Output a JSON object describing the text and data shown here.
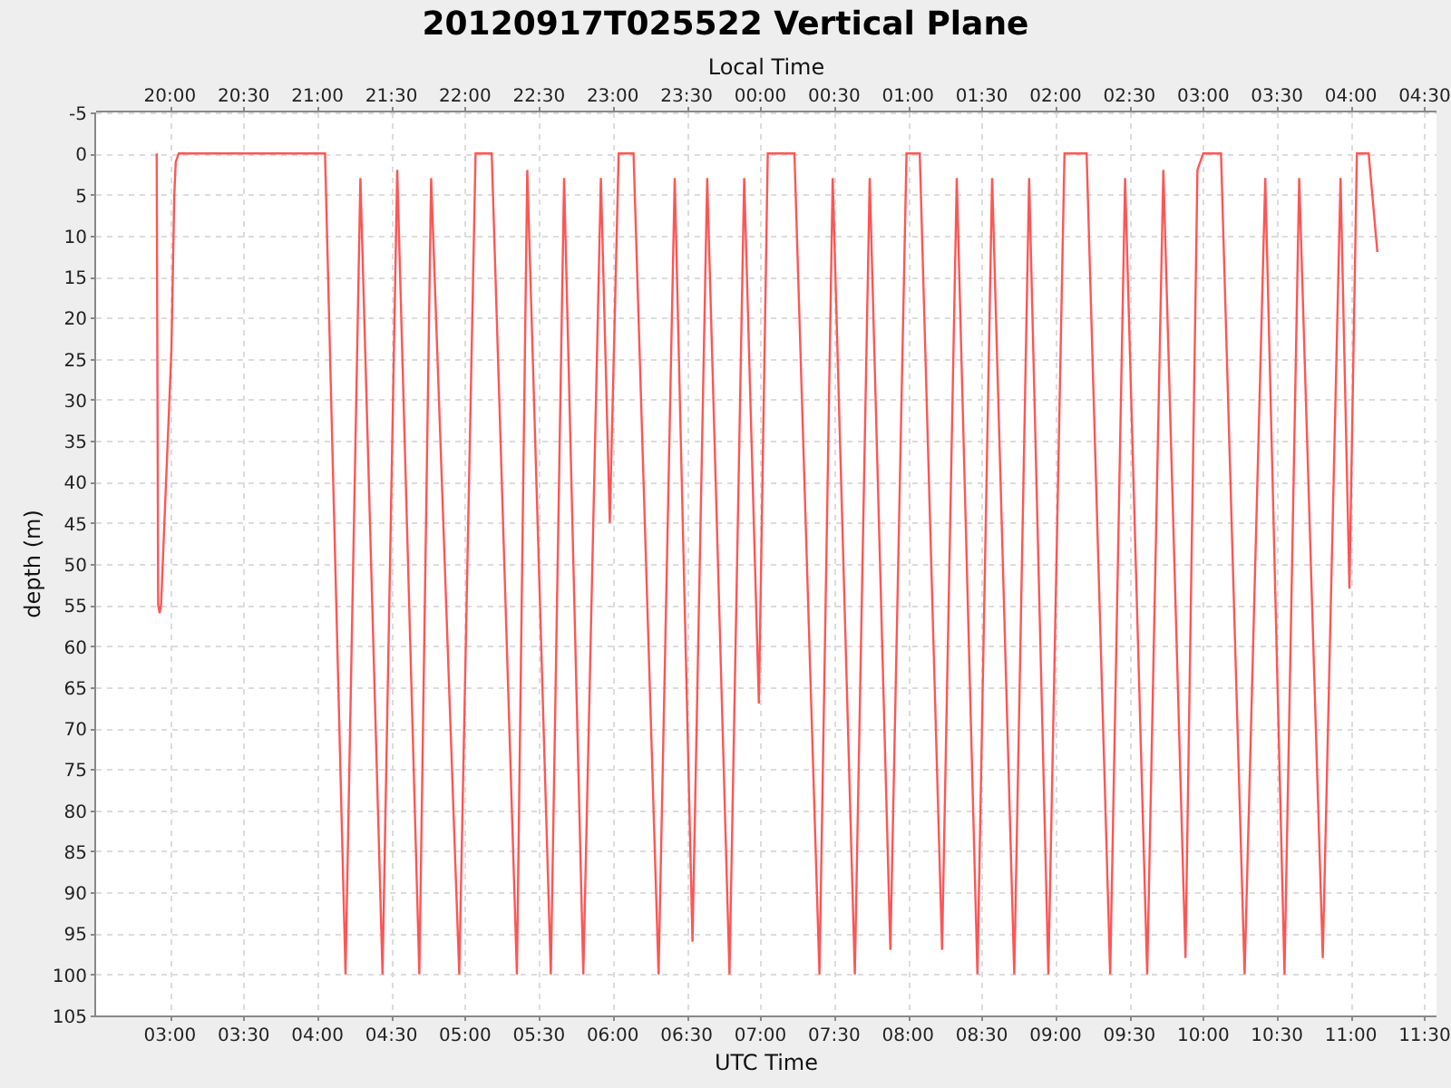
{
  "title": "20120917T025522 Vertical Plane",
  "top_axis": {
    "label": "Local Time",
    "ticks": [
      "20:00",
      "20:30",
      "21:00",
      "21:30",
      "22:00",
      "22:30",
      "23:00",
      "23:30",
      "00:00",
      "00:30",
      "01:00",
      "01:30",
      "02:00",
      "02:30",
      "03:00",
      "03:30",
      "04:00",
      "04:30"
    ]
  },
  "chart_data": {
    "type": "line",
    "xlabel": "UTC Time",
    "ylabel": "depth (m)",
    "grid": true,
    "xlim": [
      2.5,
      11.58
    ],
    "ylim": [
      105,
      -5
    ],
    "yticks": [
      -5,
      0,
      5,
      10,
      15,
      20,
      25,
      30,
      35,
      40,
      45,
      50,
      55,
      60,
      65,
      70,
      75,
      80,
      85,
      90,
      95,
      100,
      105
    ],
    "xticks": [
      {
        "value": 3,
        "label": "03:00"
      },
      {
        "value": 3.5,
        "label": "03:30"
      },
      {
        "value": 4,
        "label": "04:00"
      },
      {
        "value": 4.5,
        "label": "04:30"
      },
      {
        "value": 5,
        "label": "05:00"
      },
      {
        "value": 5.5,
        "label": "05:30"
      },
      {
        "value": 6,
        "label": "06:00"
      },
      {
        "value": 6.5,
        "label": "06:30"
      },
      {
        "value": 7,
        "label": "07:00"
      },
      {
        "value": 7.5,
        "label": "07:30"
      },
      {
        "value": 8,
        "label": "08:00"
      },
      {
        "value": 8.5,
        "label": "08:30"
      },
      {
        "value": 9,
        "label": "09:00"
      },
      {
        "value": 9.5,
        "label": "09:30"
      },
      {
        "value": 10,
        "label": "10:00"
      },
      {
        "value": 10.5,
        "label": "10:30"
      },
      {
        "value": 11,
        "label": "11:00"
      },
      {
        "value": 11.5,
        "label": "11:30"
      }
    ],
    "x": [
      2.91,
      2.92,
      2.93,
      2.94,
      3.01,
      3.03,
      3.04,
      3.06,
      4.05,
      4.19,
      4.29,
      4.44,
      4.54,
      4.69,
      4.77,
      4.96,
      5.07,
      5.18,
      5.35,
      5.42,
      5.58,
      5.67,
      5.8,
      5.92,
      5.98,
      6.04,
      6.14,
      6.31,
      6.42,
      6.54,
      6.64,
      6.79,
      6.89,
      6.99,
      7.05,
      7.23,
      7.4,
      7.49,
      7.64,
      7.74,
      7.88,
      7.99,
      8.08,
      8.23,
      8.33,
      8.47,
      8.57,
      8.72,
      8.82,
      8.95,
      9.06,
      9.21,
      9.37,
      9.47,
      9.62,
      9.73,
      9.88,
      9.96,
      10.0,
      10.12,
      10.28,
      10.42,
      10.55,
      10.65,
      10.81,
      10.93,
      10.99,
      11.04,
      11.12,
      11.18
    ],
    "series": [
      {
        "color": "#ff5555",
        "values": [
          0,
          55,
          56,
          55,
          24,
          5,
          1,
          0,
          0,
          100,
          3,
          100,
          2,
          100,
          3,
          100,
          0,
          0,
          100,
          2,
          100,
          3,
          100,
          3,
          45,
          0,
          0,
          100,
          3,
          96,
          3,
          100,
          3,
          67,
          0,
          0,
          100,
          3,
          100,
          3,
          97,
          0,
          0,
          97,
          3,
          100,
          3,
          100,
          3,
          100,
          0,
          0,
          100,
          3,
          100,
          2,
          98,
          2,
          0,
          0,
          100,
          3,
          100,
          3,
          98,
          3,
          53,
          0,
          0,
          12
        ]
      }
    ]
  }
}
